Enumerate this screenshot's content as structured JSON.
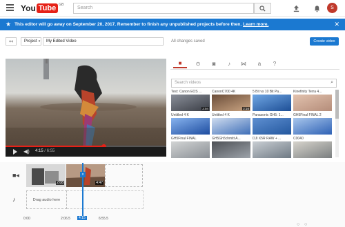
{
  "header": {
    "logo_you": "You",
    "logo_tube": "Tube",
    "logo_country": "GB",
    "search_placeholder": "Search",
    "menu_icon": "hamburger-icon",
    "search_icon": "search-icon",
    "upload_icon": "upload-icon",
    "bell_icon": "bell-icon",
    "avatar_letter": "S"
  },
  "banner": {
    "text": "This editor will go away on September 20, 2017. Remember to finish any unpublished projects before then.",
    "link": "Learn more.",
    "icon": "star-icon",
    "close_icon": "close-icon",
    "color": "#1b79d1"
  },
  "toolbar": {
    "back_label": "↤",
    "project_label": "Project",
    "project_name": "My Edited Video",
    "status": "All changes saved",
    "create_label": "Create video"
  },
  "player": {
    "current_time": "4:15",
    "total_time": "6:55",
    "progress": 0.61,
    "play_icon": "play-icon",
    "volume_icon": "volume-icon"
  },
  "library": {
    "tabs": [
      {
        "name": "video-tab",
        "glyph": "■",
        "active": true
      },
      {
        "name": "creative-commons-tab",
        "glyph": "⊙",
        "active": false
      },
      {
        "name": "photo-tab",
        "glyph": "◙",
        "active": false
      },
      {
        "name": "music-tab",
        "glyph": "♪",
        "active": false
      },
      {
        "name": "transitions-tab",
        "glyph": "⋈",
        "active": false
      },
      {
        "name": "text-tab",
        "glyph": "a",
        "active": false
      },
      {
        "name": "help-tab",
        "glyph": "?",
        "active": false
      }
    ],
    "search_placeholder": "Search videos",
    "videos": [
      {
        "title": "Test: Canon EOS ...",
        "duration": "2:04",
        "c1": "#3a3d45",
        "c2": "#8a8f99"
      },
      {
        "title": "CanonC700 4K",
        "duration": "2:16",
        "c1": "#caa482",
        "c2": "#6b4e3a"
      },
      {
        "title": "5 Bit vs 10 Bit Pa...",
        "duration": "",
        "c1": "#1e4f96",
        "c2": "#6fa6e3"
      },
      {
        "title": "Kinefinity Terra 4...",
        "duration": "",
        "c1": "#b58d7a",
        "c2": "#e2c2ae"
      },
      {
        "title": "Untitled 4 K",
        "duration": "",
        "c1": "#1e4da0",
        "c2": "#87b3ee"
      },
      {
        "title": "Untitled 4 K",
        "duration": "",
        "c1": "#3f6fb8",
        "c2": "#cfdcef"
      },
      {
        "title": "Panasonic GH5: 1...",
        "duration": "",
        "c1": "#24589f",
        "c2": "#5e8fd1"
      },
      {
        "title": "GH5Final FINAL 2",
        "duration": "",
        "c1": "#2f62b5",
        "c2": "#a8c6ec"
      },
      {
        "title": "GH5Final FINAL",
        "duration": "",
        "c1": "#8a8f95",
        "c2": "#d2d4d4"
      },
      {
        "title": "GH5Gh5chmitt A...",
        "duration": "",
        "c1": "#9da3aa",
        "c2": "#4e5156"
      },
      {
        "title": "DJI X5R RAW + ...",
        "duration": "",
        "c1": "#6f7a84",
        "c2": "#c9ced3"
      },
      {
        "title": "C0040",
        "duration": "",
        "c1": "#7b7f80",
        "c2": "#d7d4cc"
      }
    ]
  },
  "timeline": {
    "video_track_icon": "video-camera-icon",
    "audio_track_icon": "music-note-icon",
    "clips": [
      {
        "duration": "2:08",
        "c1": "#6c6c6c",
        "c2": "#d9d9d9"
      },
      {
        "duration": "4:47",
        "c1": "#7e5b40",
        "c2": "#c5a289"
      }
    ],
    "drag_audio": "Drag audio here",
    "ticks": [
      "0:00",
      "2:06.5",
      "6:55.5"
    ],
    "playhead_time": "4:15",
    "playhead_marker": "x"
  }
}
